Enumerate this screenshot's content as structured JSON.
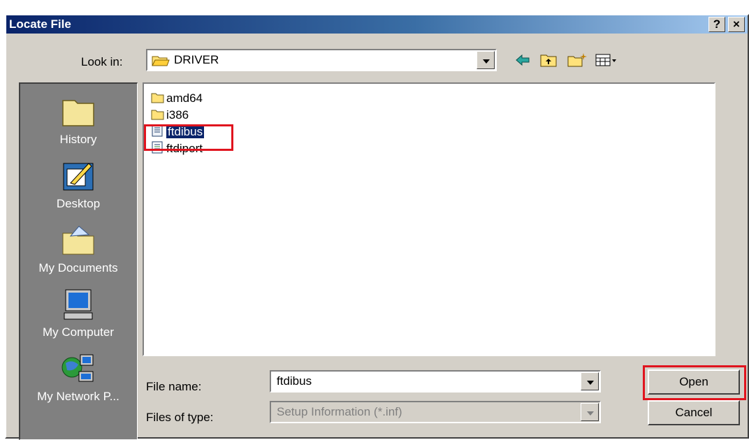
{
  "window": {
    "title": "Locate File",
    "help_glyph": "?",
    "close_glyph": "×"
  },
  "look_in": {
    "label": "Look in:",
    "value": "DRIVER"
  },
  "toolbar": {
    "back": "back-icon",
    "up": "up-folder-icon",
    "new": "new-folder-icon",
    "view": "view-menu-icon"
  },
  "places": [
    {
      "label": "History",
      "icon": "history-folder-icon"
    },
    {
      "label": "Desktop",
      "icon": "desktop-icon"
    },
    {
      "label": "My Documents",
      "icon": "my-documents-icon"
    },
    {
      "label": "My Computer",
      "icon": "my-computer-icon"
    },
    {
      "label": "My Network P...",
      "icon": "network-places-icon"
    }
  ],
  "files": [
    {
      "name": "amd64",
      "type": "folder"
    },
    {
      "name": "i386",
      "type": "folder"
    },
    {
      "name": "ftdibus",
      "type": "inf",
      "selected": true
    },
    {
      "name": "ftdiport",
      "type": "inf"
    }
  ],
  "file_name": {
    "label": "File name:",
    "value": "ftdibus"
  },
  "file_type": {
    "label": "Files of type:",
    "value": "Setup Information (*.inf)"
  },
  "buttons": {
    "open": "Open",
    "cancel": "Cancel"
  },
  "colors": {
    "highlight": "#e0141e",
    "selection": "#0a246a",
    "face": "#d4d0c8"
  }
}
